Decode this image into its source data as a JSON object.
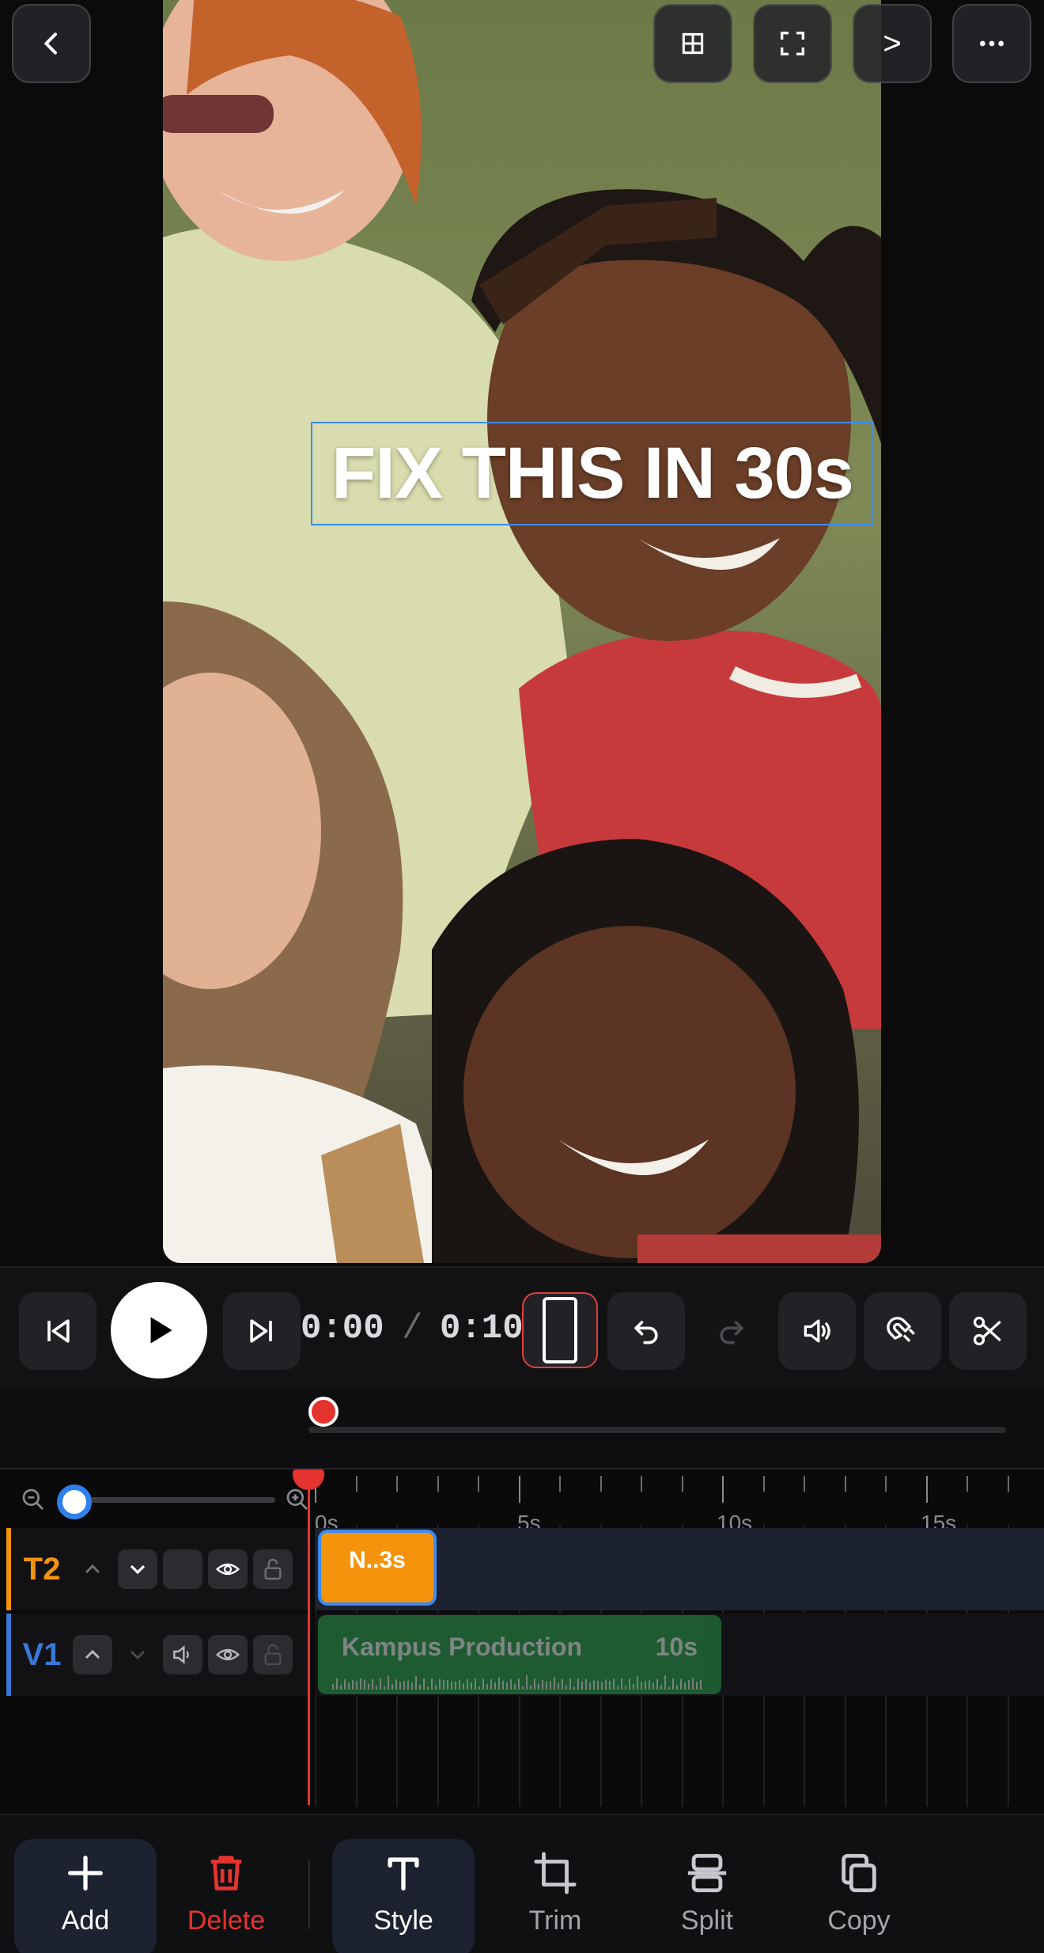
{
  "topbar": {
    "back_icon": "chevron-left-icon",
    "grid_icon": "grid-icon",
    "fullscreen_icon": "fullscreen-icon",
    "next_label": ">",
    "more_icon": "more-icon"
  },
  "preview": {
    "caption": "FIX THIS IN 30s"
  },
  "transport": {
    "current_time": "0:00",
    "separator": "/",
    "total_time": "0:10"
  },
  "timeline": {
    "ruler_labels": [
      "0s",
      "5s",
      "10s",
      "15s"
    ],
    "tracks": [
      {
        "name": "T2",
        "color": "#f5940c",
        "clip_label": "N..3s"
      },
      {
        "name": "V1",
        "color": "#3a78d8",
        "clip_label": "Kampus Production",
        "clip_duration": "10s"
      }
    ]
  },
  "bottombar": {
    "items": [
      {
        "label": "Add",
        "icon": "plus-icon"
      },
      {
        "label": "Delete",
        "icon": "trash-icon"
      },
      {
        "label": "Style",
        "icon": "text-style-icon"
      },
      {
        "label": "Trim",
        "icon": "crop-icon"
      },
      {
        "label": "Split",
        "icon": "split-icon"
      },
      {
        "label": "Copy",
        "icon": "copy-icon"
      }
    ]
  },
  "colors": {
    "accent": "#3d8bf2",
    "playhead": "#e5332f",
    "delete": "#e5332f",
    "text_clip": "#f5940c",
    "video_clip": "#2aa24c"
  }
}
